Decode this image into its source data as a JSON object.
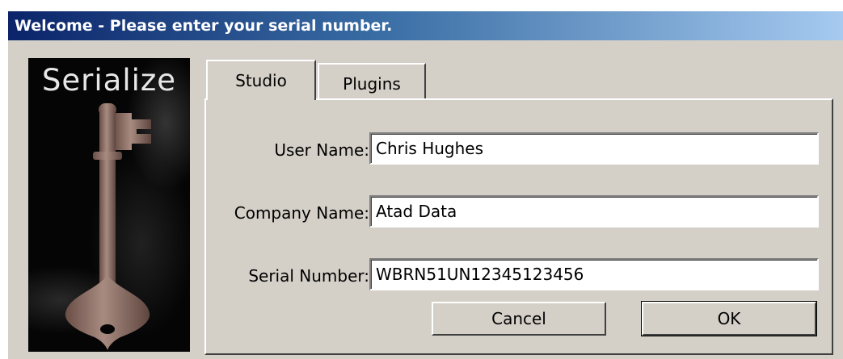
{
  "window": {
    "title": "Welcome - Please enter your serial number."
  },
  "banner": {
    "title": "Serialize",
    "image": "key-illustration"
  },
  "tabs": [
    {
      "label": "Studio",
      "selected": true
    },
    {
      "label": "Plugins",
      "selected": false
    }
  ],
  "form": {
    "user_name": {
      "label": "User Name:",
      "value": "Chris Hughes"
    },
    "company_name": {
      "label": "Company Name:",
      "value": "Atad Data"
    },
    "serial_number": {
      "label": "Serial Number:",
      "value": "WBRN51UN12345123456"
    }
  },
  "buttons": {
    "cancel_label": "Cancel",
    "ok_label": "OK"
  },
  "colors": {
    "title_gradient_start": "#0b246a",
    "title_gradient_end": "#a6caf0",
    "dialog_face": "#d4d0c8",
    "key_metal": "#8a6e63"
  }
}
